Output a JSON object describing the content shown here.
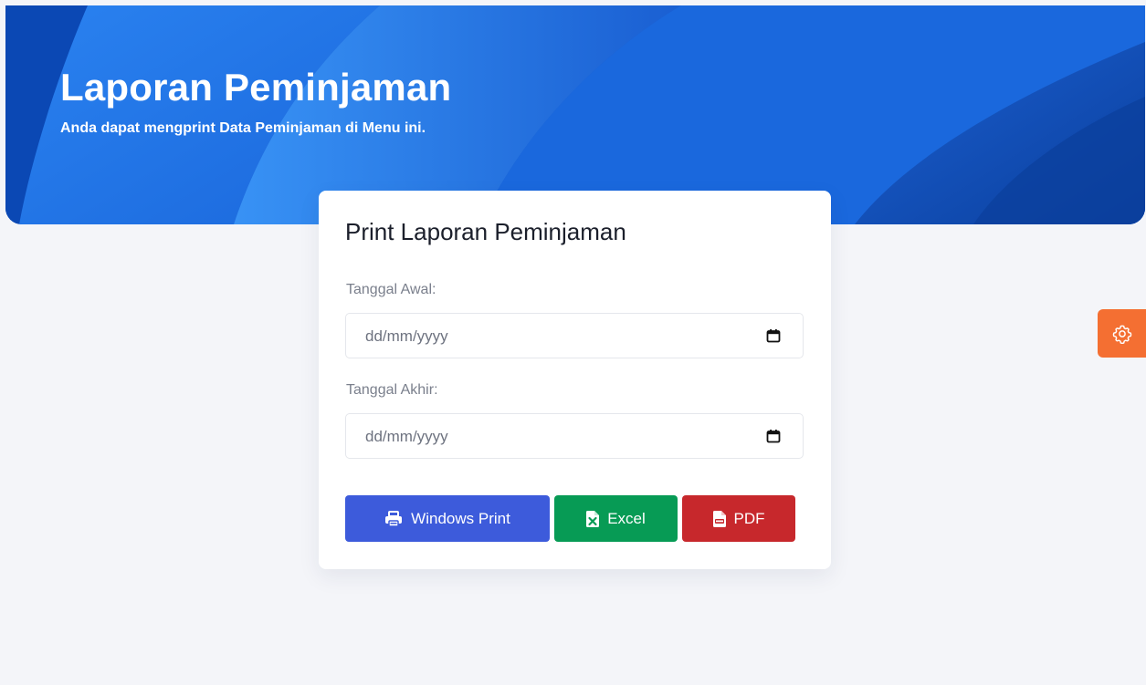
{
  "header": {
    "title": "Laporan Peminjaman",
    "subtitle": "Anda dapat mengprint Data Peminjaman di Menu ini."
  },
  "form": {
    "title": "Print Laporan Peminjaman",
    "start_date": {
      "label": "Tanggal Awal:",
      "placeholder": "dd/mm/yyyy"
    },
    "end_date": {
      "label": "Tanggal Akhir:",
      "placeholder": "dd/mm/yyyy"
    },
    "buttons": {
      "print_label": "Windows Print",
      "excel_label": "Excel",
      "pdf_label": "PDF"
    }
  },
  "icons": {
    "print": "printer-icon",
    "excel": "file-excel-icon",
    "pdf": "file-pdf-icon",
    "calendar": "calendar-icon",
    "settings": "gear-icon"
  },
  "colors": {
    "hero_blue": "#1565d8",
    "print_button": "#3d5bdb",
    "excel_button": "#079b55",
    "pdf_button": "#c7282c",
    "settings_button": "#f46f32"
  }
}
